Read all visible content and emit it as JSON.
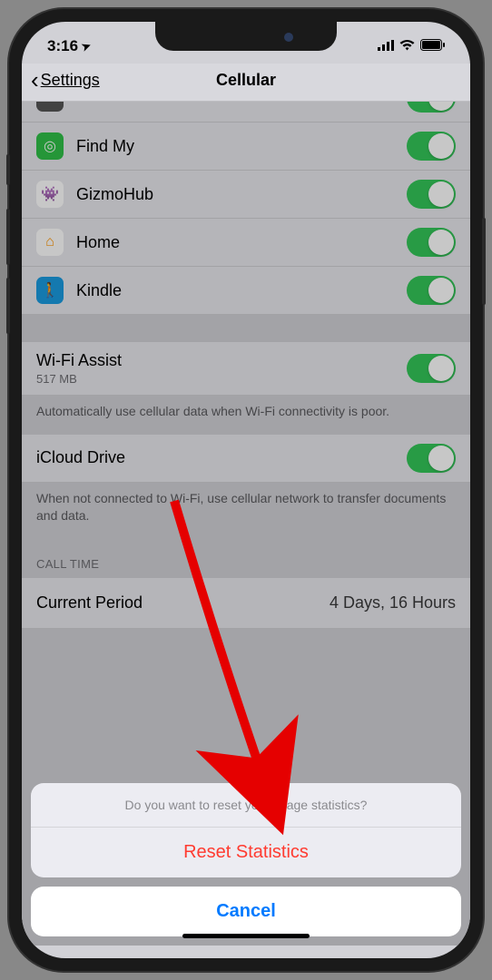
{
  "status": {
    "time": "3:16",
    "location_glyph": "➤"
  },
  "nav": {
    "back": "Settings",
    "title": "Cellular"
  },
  "apps": [
    {
      "name": "Find My",
      "icon_bg": "#30c048",
      "glyph": "◎",
      "glyph_color": "#fff"
    },
    {
      "name": "GizmoHub",
      "icon_bg": "#fff",
      "glyph": "👾",
      "glyph_color": "#7a2a7a"
    },
    {
      "name": "Home",
      "icon_bg": "#fff",
      "glyph": "⌂",
      "glyph_color": "#ff9500"
    },
    {
      "name": "Kindle",
      "icon_bg": "#1a9be0",
      "glyph": "🚶",
      "glyph_color": "#000"
    }
  ],
  "wifi_assist": {
    "label": "Wi-Fi Assist",
    "sub": "517 MB",
    "footer": "Automatically use cellular data when Wi-Fi connectivity is poor."
  },
  "icloud_drive": {
    "label": "iCloud Drive",
    "footer": "When not connected to Wi-Fi, use cellular network to transfer documents and data."
  },
  "call_time": {
    "header": "CALL TIME",
    "current_label": "Current Period",
    "current_value": "4 Days, 16 Hours"
  },
  "sheet": {
    "message": "Do you want to reset your usage statistics?",
    "reset": "Reset Statistics",
    "cancel": "Cancel"
  }
}
